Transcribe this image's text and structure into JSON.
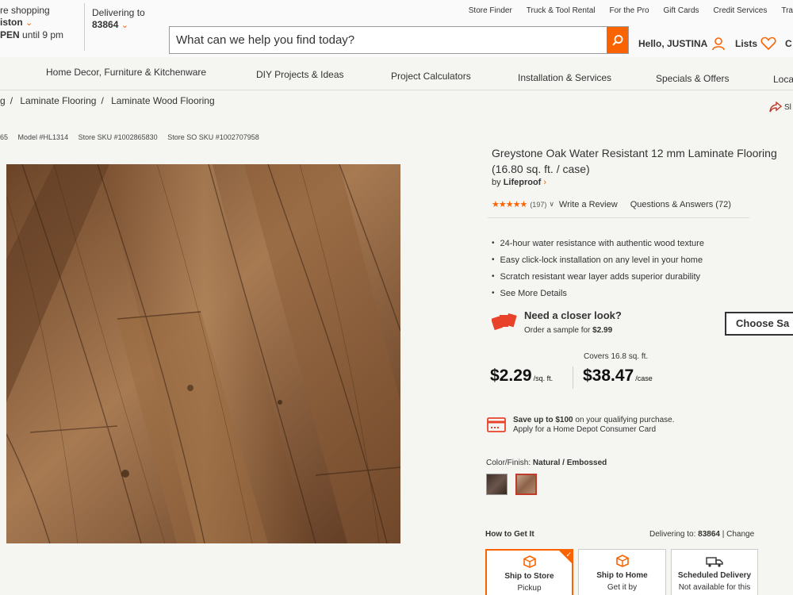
{
  "header": {
    "store_line1": "re shopping",
    "store_name": "iston",
    "store_hours_status": "PEN",
    "store_hours": " until 9 pm",
    "delivering_label": "Delivering to",
    "zip": "83864",
    "utility_links": [
      "Store Finder",
      "Truck & Tool Rental",
      "For the Pro",
      "Gift Cards",
      "Credit Services",
      "Tra"
    ],
    "search_placeholder": "What can we help you find today?",
    "greeting": "Hello, JUSTINA",
    "lists_label": "Lists",
    "cart_partial": "C"
  },
  "nav": {
    "items": [
      "Home Decor, Furniture & Kitchenware",
      "DIY Projects & Ideas",
      "Project Calculators",
      "Installation & Services",
      "Specials & Offers",
      "Loca"
    ]
  },
  "breadcrumb": {
    "items": [
      "g",
      "Laminate Flooring",
      "Laminate Wood Flooring"
    ],
    "share_label": "Sl"
  },
  "product_ids": {
    "internet_partial": "65",
    "model": "Model #HL1314",
    "store_sku": "Store SKU #1002865830",
    "store_so_sku": "Store SO SKU #1002707958"
  },
  "product": {
    "title": "Greystone Oak Water Resistant 12 mm Laminate Flooring (16.80 sq. ft. / case)",
    "brand_prefix": "by ",
    "brand": "Lifeproof",
    "rating": 4.5,
    "stars": "★★★★★",
    "review_count": "(197)",
    "write_review": "Write a Review",
    "qa": "Questions & Answers (72)",
    "bullets": [
      "24-hour water resistance with authentic wood texture",
      "Easy click-lock installation on any level in your home",
      "Scratch resistant wear layer adds superior durability",
      "See More Details"
    ],
    "sample_title": "Need a closer look?",
    "sample_sub_prefix": "Order a sample for ",
    "sample_price": "$2.99",
    "choose_button": "Choose Sa",
    "covers": "Covers 16.8 sq. ft.",
    "price_sqft": "$2.29",
    "price_sqft_unit": "/sq. ft.",
    "price_case": "$38.47",
    "price_case_unit": "/case",
    "card_save_prefix": "Save up to ",
    "card_save_amount": "$100",
    "card_save_suffix": " on your qualifying purchase.",
    "card_apply": "Apply for a Home Depot Consumer Card",
    "color_label": "Color/Finish: ",
    "color_value": "Natural / Embossed",
    "swatches": [
      {
        "name": "dark",
        "color": "#4a3a33"
      },
      {
        "name": "natural",
        "color": "#a47a5c"
      }
    ],
    "how_to_get": "How to Get It",
    "delivering_to_label": "Delivering to: ",
    "delivering_zip": "83864",
    "change_label": "| Change",
    "fulfillment": [
      {
        "title": "Ship to Store",
        "sub": "Pickup"
      },
      {
        "title": "Ship to Home",
        "sub": "Get it by"
      },
      {
        "title": "Scheduled Delivery",
        "sub": "Not available for this"
      }
    ]
  },
  "colors": {
    "accent": "#f96302"
  }
}
